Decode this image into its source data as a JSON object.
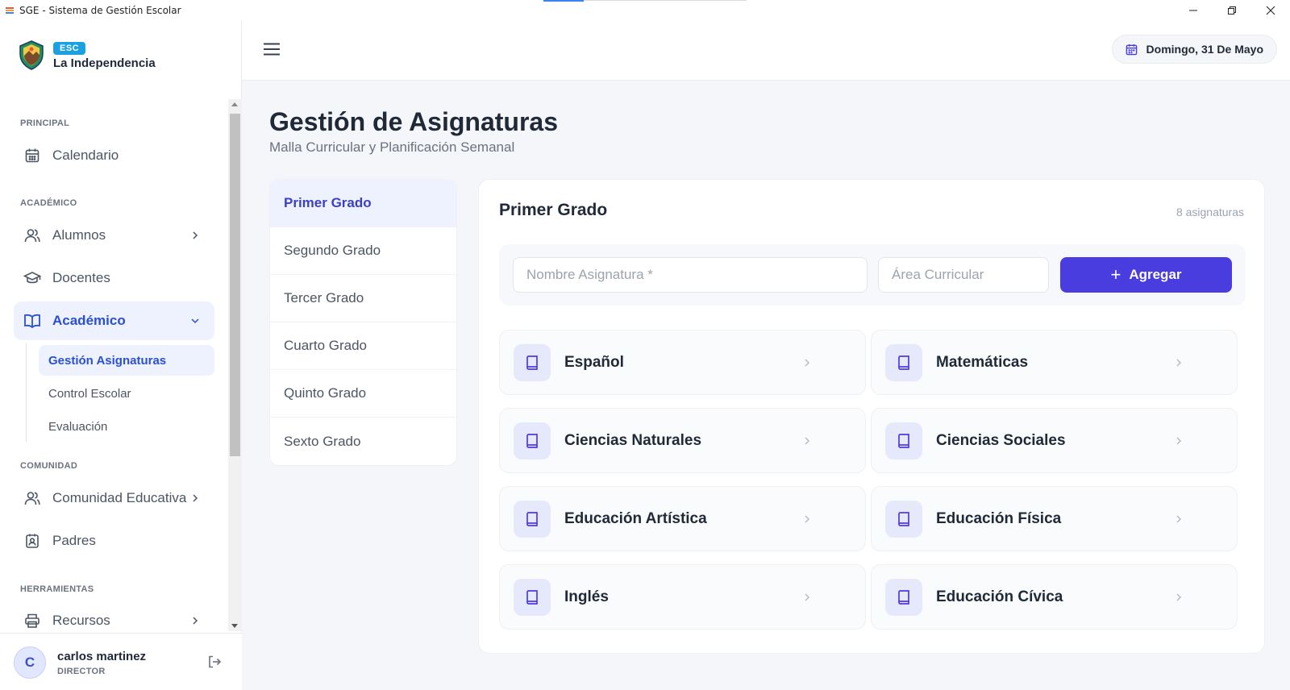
{
  "window": {
    "title": "SGE - Sistema de Gestión Escolar",
    "controls": [
      "minimize-icon",
      "restore-icon",
      "close-icon"
    ]
  },
  "brand": {
    "badge": "ESC",
    "school": "La Independencia"
  },
  "sidebar": {
    "sections": {
      "principal": "PRINCIPAL",
      "academico": "ACADÉMICO",
      "comunidad": "COMUNIDAD",
      "herramientas": "HERRAMIENTAS"
    },
    "items": {
      "calendario": "Calendario",
      "alumnos": "Alumnos",
      "docentes": "Docentes",
      "academico": "Académico",
      "comunidad_educativa": "Comunidad Educativa",
      "padres": "Padres",
      "recursos": "Recursos"
    },
    "subitems": {
      "gestion_asignaturas": "Gestión Asignaturas",
      "control_escolar": "Control Escolar",
      "evaluacion": "Evaluación"
    }
  },
  "user": {
    "initial": "C",
    "name": "carlos martinez",
    "role": "DIRECTOR"
  },
  "header": {
    "date": "Domingo, 31 De Mayo"
  },
  "page": {
    "title": "Gestión de Asignaturas",
    "subtitle": "Malla Curricular y Planificación Semanal"
  },
  "grades": [
    "Primer Grado",
    "Segundo Grado",
    "Tercer Grado",
    "Cuarto Grado",
    "Quinto Grado",
    "Sexto Grado"
  ],
  "selected_grade": "Primer Grado",
  "panel": {
    "title": "Primer Grado",
    "count": "8 asignaturas",
    "name_placeholder": "Nombre Asignatura *",
    "area_placeholder": "Área Curricular",
    "add_label": "Agregar"
  },
  "subjects": [
    "Español",
    "Matemáticas",
    "Ciencias Naturales",
    "Ciencias Sociales",
    "Educación Artística",
    "Educación Física",
    "Inglés",
    "Educación Cívica"
  ],
  "colors": {
    "accent": "#4a3de0",
    "active_nav": "#2b4fd1",
    "active_bg": "#eef2ff",
    "badge": "#1ba1e2"
  }
}
